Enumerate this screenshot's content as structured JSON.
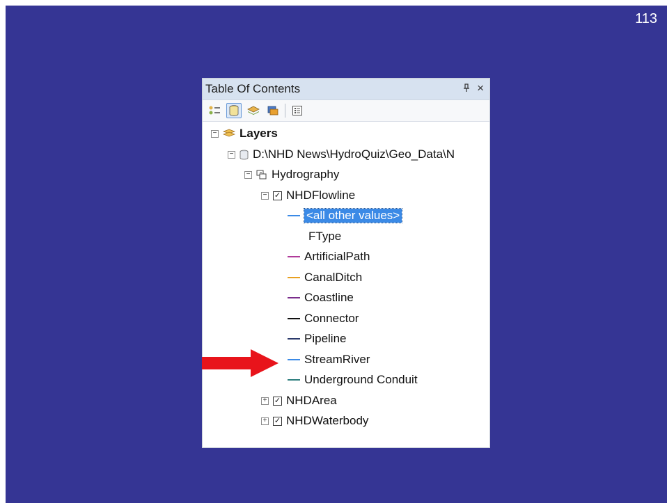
{
  "slide": {
    "number": "113",
    "background": "#353594"
  },
  "toc": {
    "title": "Table Of Contents",
    "pin_icon": "q",
    "close_icon": "×"
  },
  "tree": {
    "root": {
      "label": "Layers"
    },
    "data_frame": {
      "label": "D:\\NHD News\\HydroQuiz\\Geo_Data\\N"
    },
    "group": {
      "label": "Hydrography"
    },
    "layers": [
      {
        "label": "NHDFlowline",
        "checked": true,
        "expanded": true
      },
      {
        "label": "NHDArea",
        "checked": true,
        "expanded": false
      },
      {
        "label": "NHDWaterbody",
        "checked": true,
        "expanded": false
      }
    ],
    "symbols": {
      "all_other": {
        "label": "<all other values>",
        "color": "#3b8ae6"
      },
      "field_label": "FType",
      "values": [
        {
          "label": "ArtificialPath",
          "color": "#b03a9a"
        },
        {
          "label": "CanalDitch",
          "color": "#e8a021"
        },
        {
          "label": "Coastline",
          "color": "#7a2d8c"
        },
        {
          "label": "Connector",
          "color": "#111111"
        },
        {
          "label": "Pipeline",
          "color": "#2b3a6b"
        },
        {
          "label": "StreamRiver",
          "color": "#3b8ae6"
        },
        {
          "label": "Underground Conduit",
          "color": "#2f7f7f"
        }
      ]
    }
  },
  "arrow": {
    "color": "#e8141b",
    "points_to": "StreamRiver"
  }
}
